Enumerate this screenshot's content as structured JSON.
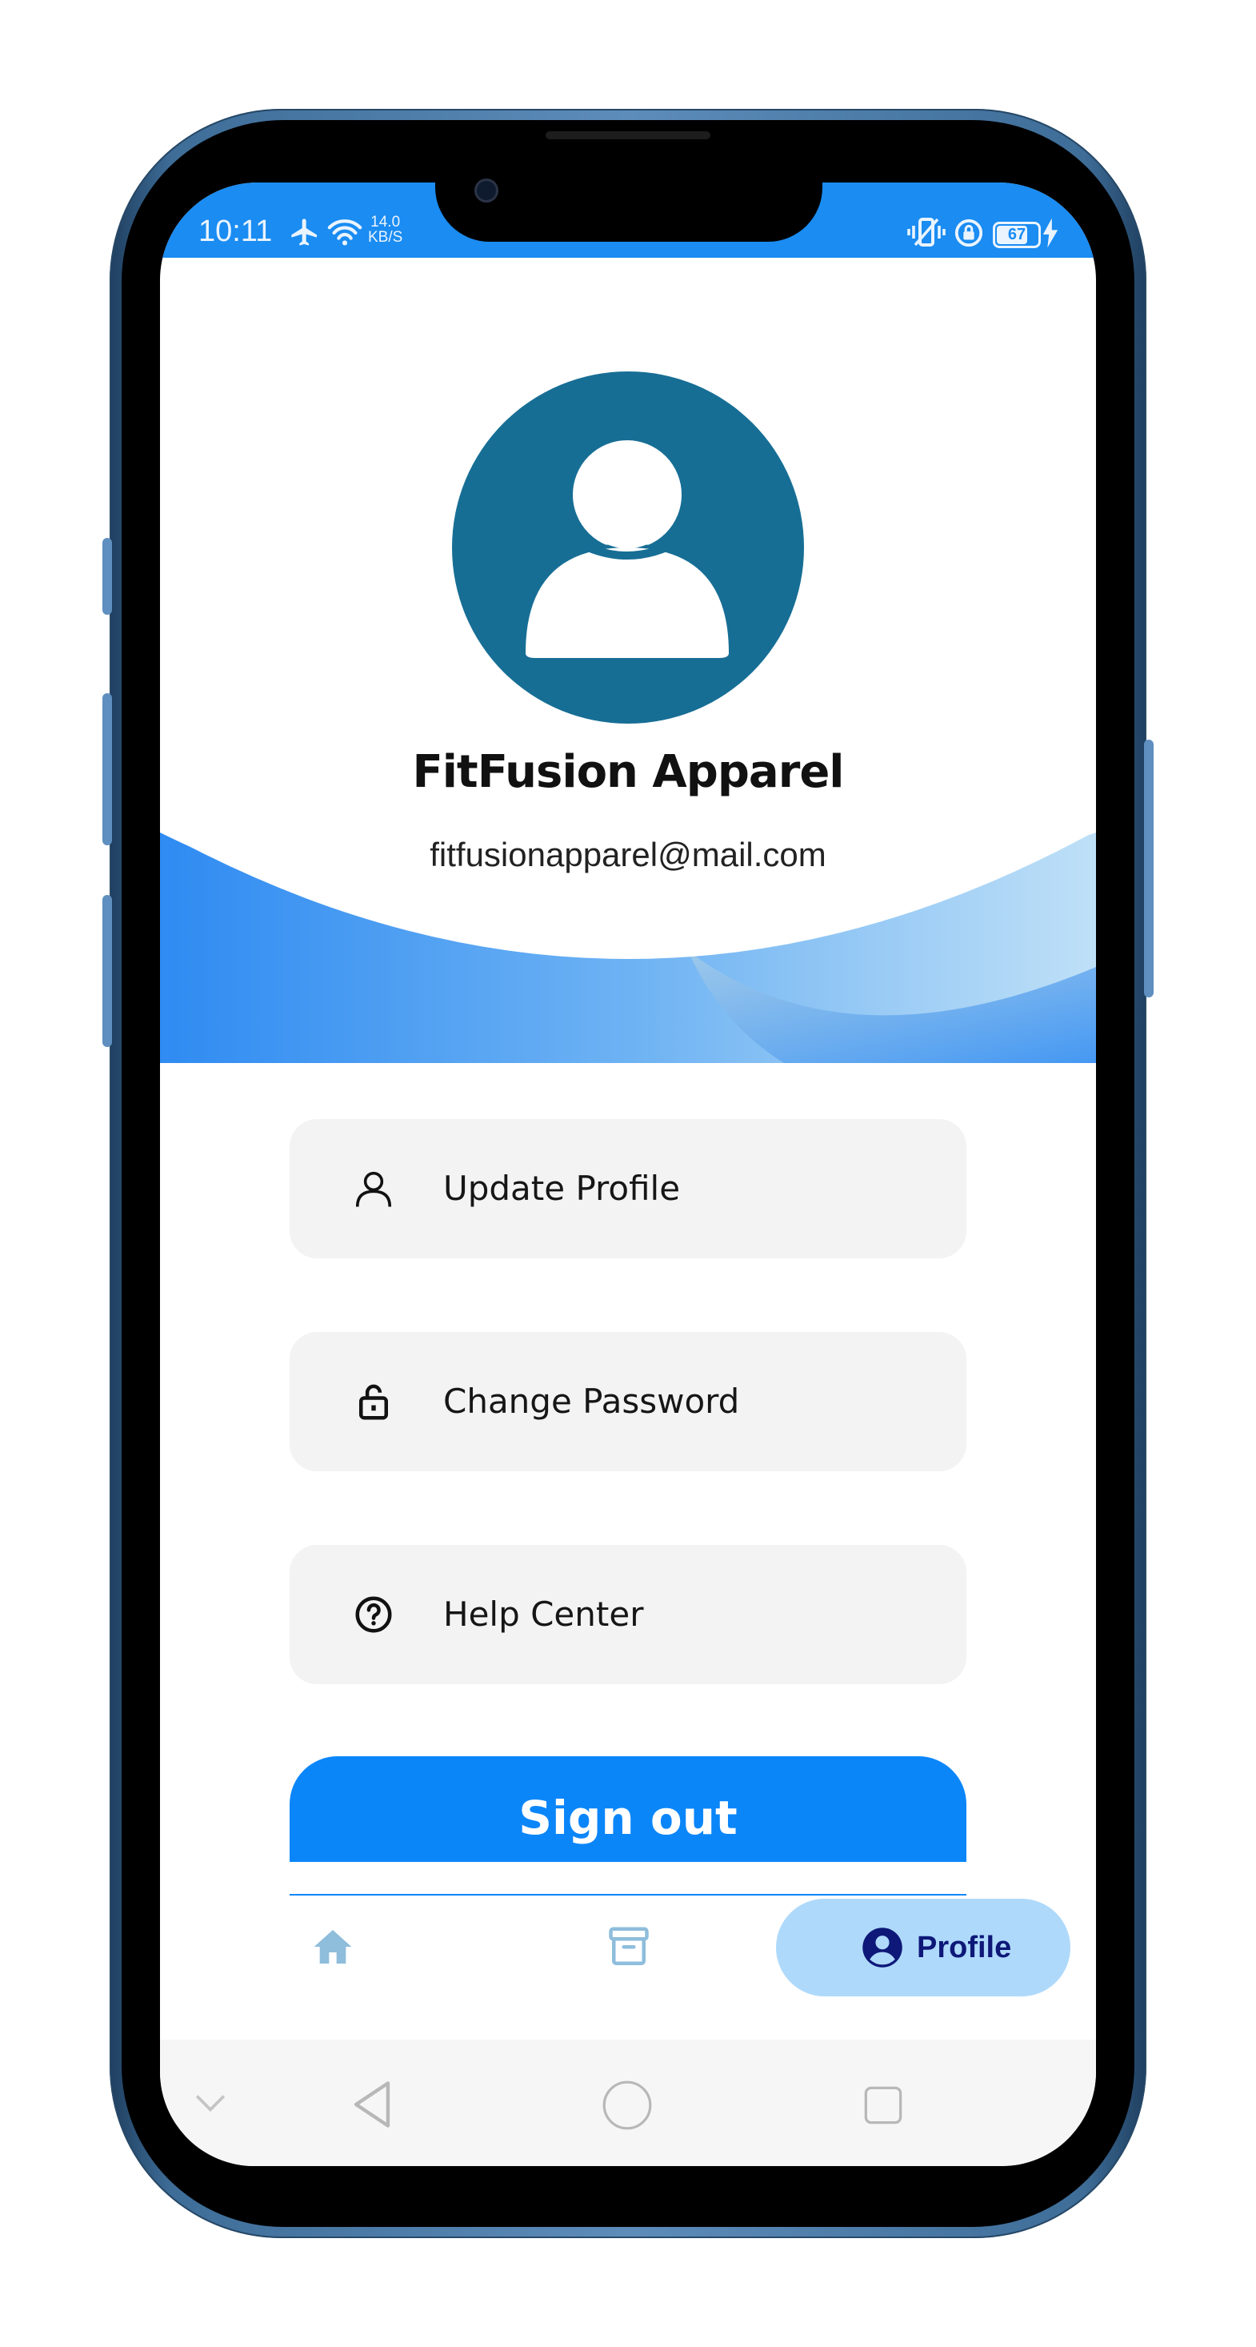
{
  "status_bar": {
    "time": "10:11",
    "net_speed_value": "14.0",
    "net_speed_unit": "KB/S",
    "battery": "67",
    "color": "#1a8cf2"
  },
  "profile": {
    "name": "FitFusion Apparel",
    "email": "fitfusionapparel@mail.com",
    "avatar_icon": "person-icon",
    "avatar_color": "#176e95"
  },
  "menu": {
    "items": [
      {
        "label": "Update Profile",
        "icon": "person-outline-icon"
      },
      {
        "label": "Change Password",
        "icon": "lock-open-icon"
      },
      {
        "label": "Help Center",
        "icon": "help-circle-icon"
      }
    ],
    "signout_label": "Sign out",
    "accent": "#0b86f9"
  },
  "bottom_nav": {
    "items": [
      {
        "icon": "home-icon",
        "active": false
      },
      {
        "icon": "archive-icon",
        "active": false
      },
      {
        "icon": "account-circle-icon",
        "label": "Profile",
        "active": true
      }
    ],
    "active_bg": "#aed9fb"
  },
  "system_nav": {
    "buttons": [
      "chevron-down-icon",
      "back-icon",
      "home-circle-icon",
      "recents-icon"
    ]
  }
}
